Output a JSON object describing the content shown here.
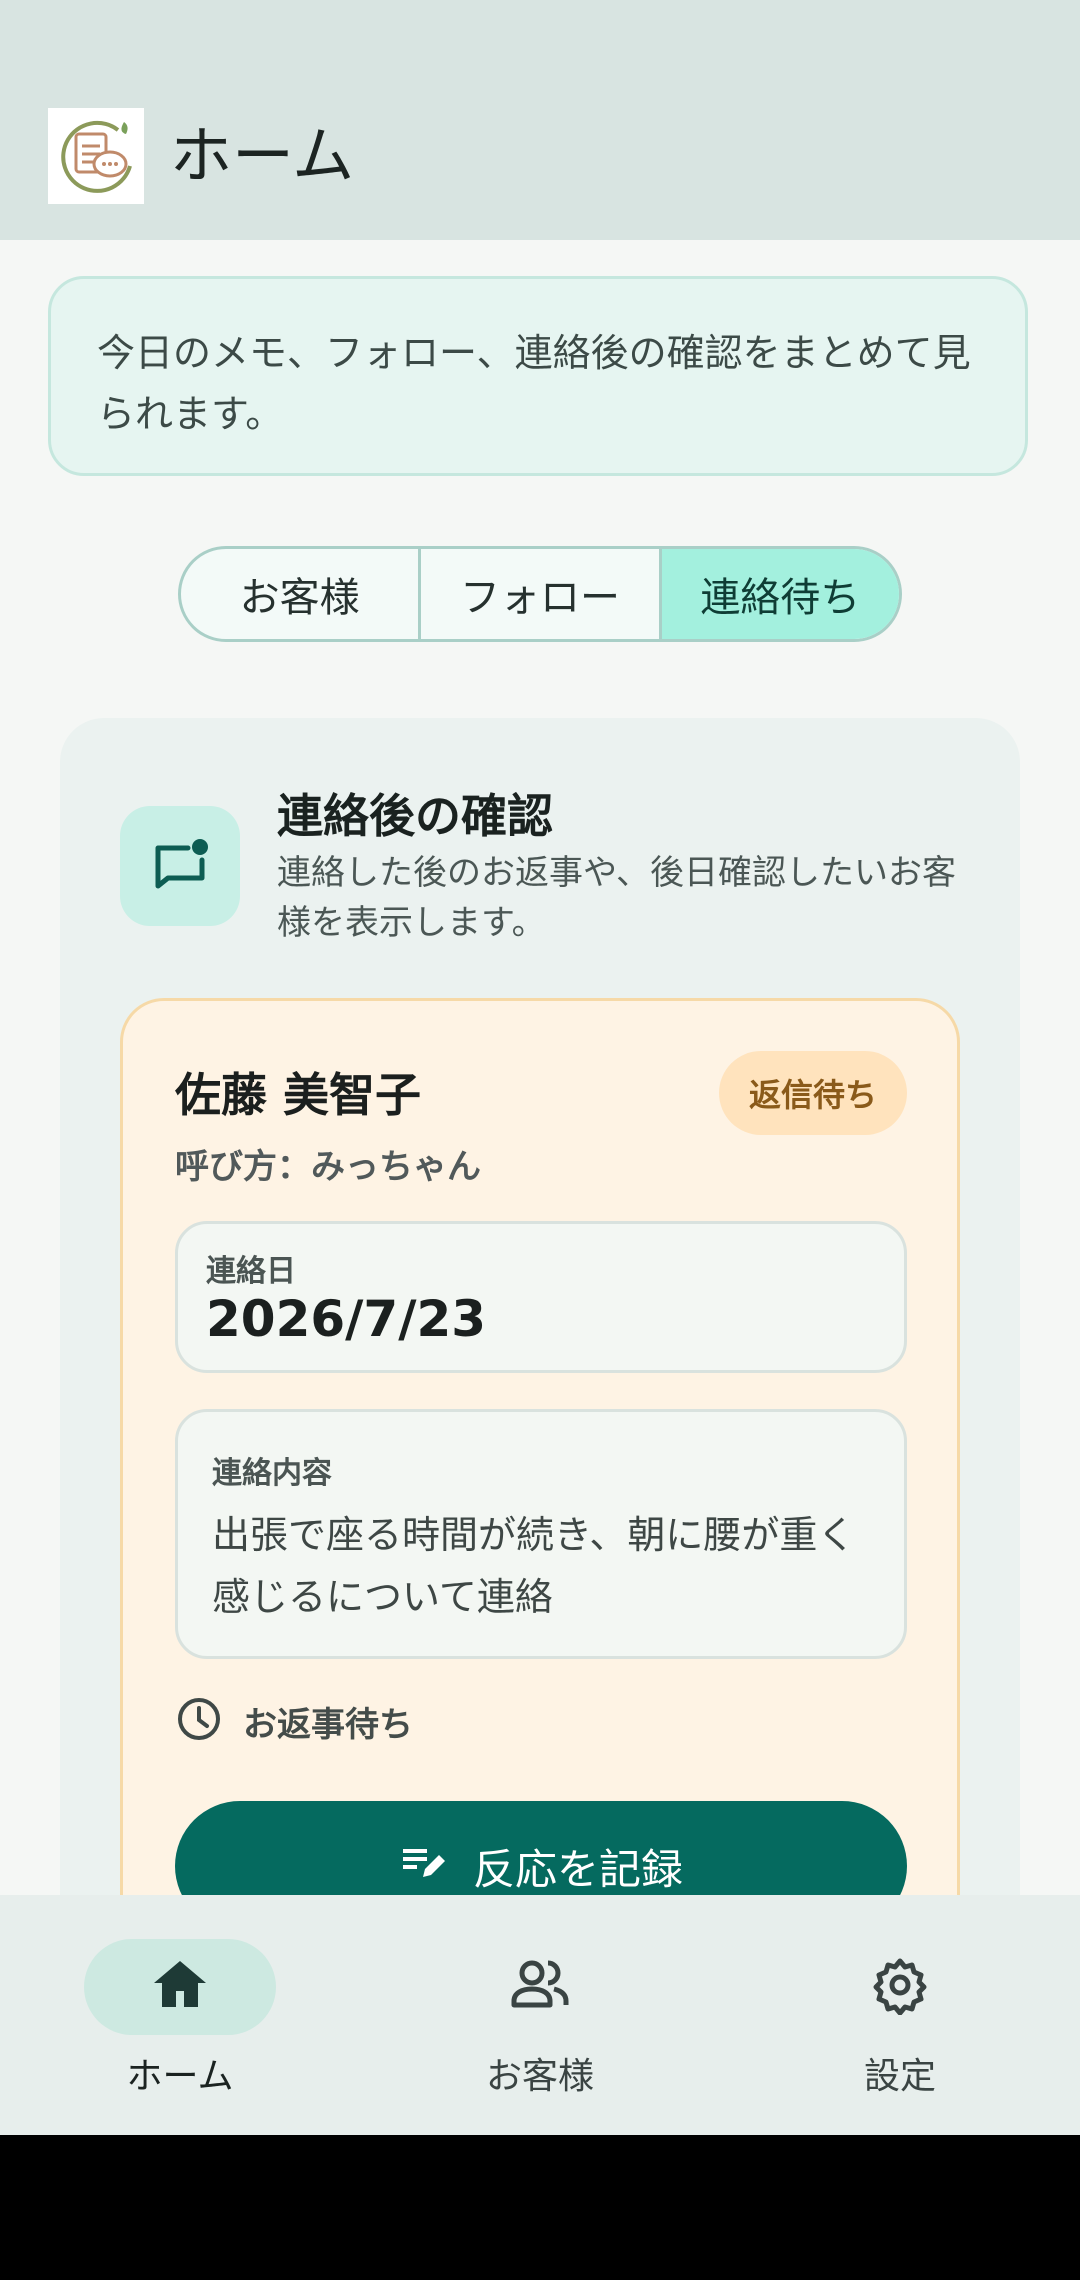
{
  "appbar": {
    "title": "ホーム"
  },
  "intro": {
    "text": "今日のメモ、フォロー、連絡後の確認をまとめて見られます。"
  },
  "tabs": [
    {
      "label": "お客様",
      "active": false
    },
    {
      "label": "フォロー",
      "active": false
    },
    {
      "label": "連絡待ち",
      "active": true
    }
  ],
  "section": {
    "title": "連絡後の確認",
    "description": "連絡した後のお返事や、後日確認したいお客様を表示します。",
    "icon": "chat-notification-icon"
  },
  "customer": {
    "name": "佐藤 美智子",
    "badge": "返信待ち",
    "nickname": "呼び方：みっちゃん",
    "date_label": "連絡日",
    "date_value": "2026/7/23",
    "content_label": "連絡内容",
    "content_value": "出張で座る時間が続き、朝に腰が重く感じるについて連絡",
    "status_text": "お返事待ち",
    "action_label": "反応を記録"
  },
  "nav": {
    "items": [
      {
        "label": "ホーム",
        "icon": "home-icon",
        "active": true
      },
      {
        "label": "お客様",
        "icon": "people-icon",
        "active": false
      },
      {
        "label": "設定",
        "icon": "gear-icon",
        "active": false
      }
    ]
  },
  "colors": {
    "accent": "#056a5f",
    "active_tab": "#a3f0de",
    "badge_bg": "#ffe3bd",
    "card_bg": "#fef3e4"
  }
}
